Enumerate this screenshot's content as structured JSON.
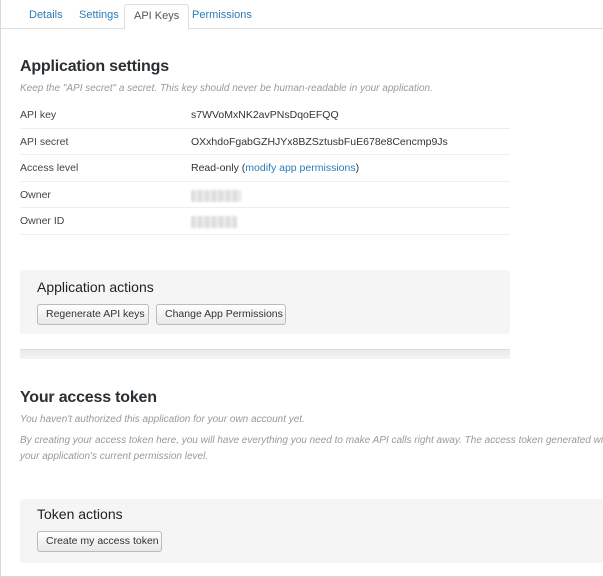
{
  "tabs": [
    {
      "label": "Details",
      "active": false
    },
    {
      "label": "Settings",
      "active": false
    },
    {
      "label": "API Keys",
      "active": true
    },
    {
      "label": "Permissions",
      "active": false
    }
  ],
  "app_settings": {
    "title": "Application settings",
    "note": "Keep the \"API secret\" a secret. This key should never be human-readable in your application.",
    "rows": {
      "api_key": {
        "label": "API key",
        "value": "s7WVoMxNK2avPNsDqoEFQQ"
      },
      "api_secret": {
        "label": "API secret",
        "value": "OXxhdoFgabGZHJYx8BZSztusbFuE678e8Cencmp9Js"
      },
      "access_level": {
        "label": "Access level",
        "value": "Read-only (",
        "link": "modify app permissions",
        "suffix": ")"
      },
      "owner": {
        "label": "Owner"
      },
      "owner_id": {
        "label": "Owner ID"
      }
    }
  },
  "app_actions": {
    "title": "Application actions",
    "regenerate_label": "Regenerate API keys",
    "change_permissions_label": "Change App Permissions"
  },
  "access_token": {
    "title": "Your access token",
    "note1": "You haven't authorized this application for your own account yet.",
    "note2_line1": "By creating your access token here, you will have everything you need to make API calls right away. The access token generated wil",
    "note2_line2": "your application's current permission level."
  },
  "token_actions": {
    "title": "Token actions",
    "create_label": "Create my access token"
  }
}
